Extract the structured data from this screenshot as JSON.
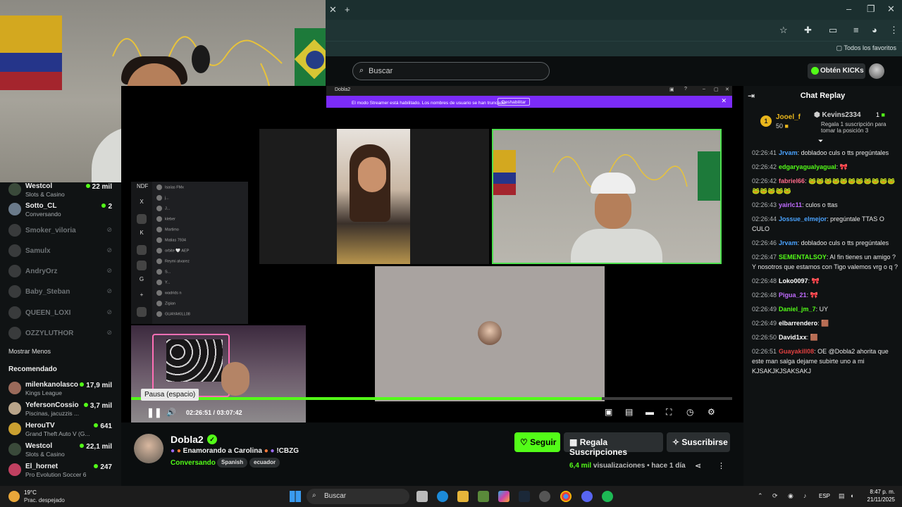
{
  "browser": {
    "tab_close": "✕",
    "tab_new": "+",
    "bookmarks_label": "Todos los favoritos"
  },
  "kick_header": {
    "search_placeholder": "Buscar",
    "kicks_button": "Obtén KICKs"
  },
  "sidebar": {
    "following": [
      {
        "name": "Westcol",
        "sub": "Slots & Casino",
        "viewers": "22 mil",
        "live": true,
        "color": "#3a4a3a"
      },
      {
        "name": "Sotto_CL",
        "sub": "Conversando",
        "viewers": "2",
        "live": true,
        "color": "#6a7a8a"
      },
      {
        "name": "Smoker_viloria",
        "live": false
      },
      {
        "name": "Samulx",
        "live": false
      },
      {
        "name": "AndryOrz",
        "live": false
      },
      {
        "name": "Baby_Steban",
        "live": false
      },
      {
        "name": "QUEEN_LOXI",
        "live": false
      },
      {
        "name": "OZZYLUTHOR",
        "live": false
      }
    ],
    "show_less": "Mostrar Menos",
    "recommended_title": "Recomendado",
    "recommended": [
      {
        "name": "milenkanolasco",
        "sub": "Kings League",
        "viewers": "17,9 mil",
        "color": "#9a6a5a"
      },
      {
        "name": "YefersonCossio",
        "sub": "Piscinas, jacuzzis ...",
        "viewers": "3,7 mil",
        "color": "#b9a58a"
      },
      {
        "name": "HerouTV",
        "sub": "Grand Theft Auto V (G...",
        "viewers": "641",
        "color": "#caa030"
      },
      {
        "name": "Westcol",
        "sub": "Slots & Casino",
        "viewers": "22,1 mil",
        "color": "#3a4a3a"
      },
      {
        "name": "El_hornet",
        "sub": "Pro Evolution Soccer 6",
        "viewers": "247",
        "color": "#c04060"
      }
    ]
  },
  "player": {
    "inner_window_title": "Dobla2",
    "streamer_mode_msg": "El modo Streamer está habilitado. Los nombres de usuario se han truncado.",
    "streamer_mode_button": "Deshabilitar",
    "discord_members": [
      "Isaías FMx",
      "j...",
      "J...",
      "kleber",
      "Martimo",
      "Matias 7934",
      "orbite 🤍 AEP",
      "Reymi alvarez",
      "S...",
      "Y...",
      "wadrids n",
      "Zigian",
      "GUAYAKILL08"
    ],
    "discord_rail": [
      "NDF",
      "X",
      "",
      "K",
      "",
      "",
      "G",
      "+",
      ""
    ],
    "tooltip": "Pausa (espacio)",
    "time_current": "02:26:51",
    "time_separator": "/",
    "time_total": "03:07:42",
    "progress": 0.7826,
    "icons": {
      "pause": "❚❚",
      "volume": "🔊"
    }
  },
  "streamer": {
    "name": "Dobla2",
    "title": "Enamorando a Carolina",
    "title_suffix": "!CBZG",
    "category": "Conversando",
    "tags": [
      "Spanish",
      "ecuador"
    ],
    "follow": "Seguir",
    "gift": "Regala Suscripciones",
    "subscribe": "Suscribirse",
    "views_num": "6,4 mil",
    "views_label": "visualizaciones",
    "ago": "hace 1 día"
  },
  "chat": {
    "title": "Chat Replay",
    "leader_rank": "1",
    "leader_user": "Jooel_f",
    "leader_points": "50",
    "second_user": "Kevins2334",
    "second_count": "1",
    "second_sub": "Regala 1 suscripción para tomar la posición 3",
    "messages": [
      {
        "ts": "02:26:41",
        "user": "Jrvam",
        "color": "#4aa3ff",
        "text": "dobladoo culs o tts pregúntales"
      },
      {
        "ts": "02:26:42",
        "user": "edgaryagualyagual",
        "color": "#53fc18",
        "text": "🎀"
      },
      {
        "ts": "02:26:42",
        "user": "fabriel66",
        "color": "#ff6b8a",
        "text": "🐸🐸🐸🐸🐸🐸🐸🐸🐸🐸🐸🐸🐸🐸🐸🐸"
      },
      {
        "ts": "02:26:43",
        "user": "yairlc11",
        "color": "#c06bff",
        "text": "culos o ttas"
      },
      {
        "ts": "02:26:44",
        "user": "Jossue_elmejor",
        "color": "#4aa3ff",
        "text": "pregúntale TTAS O CULO"
      },
      {
        "ts": "02:26:46",
        "user": "Jrvam",
        "color": "#4aa3ff",
        "text": "dobladoo culs o tts pregúntales"
      },
      {
        "ts": "02:26:47",
        "user": "SEMENTALSOY",
        "color": "#53fc18",
        "text": "Al fin tienes un amigo ? Y nosotros que estamos con Tigo valemos vrg o q ?"
      },
      {
        "ts": "02:26:48",
        "user": "Loko0097",
        "color": "#ffffff",
        "text": "🎀"
      },
      {
        "ts": "02:26:48",
        "user": "Pigua_21",
        "color": "#c06bff",
        "text": "🎀"
      },
      {
        "ts": "02:26:49",
        "user": "Daniel_jm_7",
        "color": "#53fc18",
        "text": "UY"
      },
      {
        "ts": "02:26:49",
        "user": "elbarrendero",
        "color": "#ffffff",
        "text": "🟫"
      },
      {
        "ts": "02:26:50",
        "user": "David1xx",
        "color": "#ffffff",
        "text": "🟫"
      },
      {
        "ts": "02:26:51",
        "user": "Guayakill08",
        "color": "#e04040",
        "text": "OE @Dobla2 ahorita que este man salga dejame subirte uno a mi KJSAKJKJSAKSAKJ"
      }
    ]
  },
  "taskbar": {
    "temp": "19°C",
    "weather": "Prac. despejado",
    "search": "Buscar",
    "lang": "ESP",
    "time": "8:47 p. m.",
    "date": "21/11/2025"
  },
  "colors": {
    "kick_green": "#53fc18",
    "streamer_bar": "#7b2bf9"
  }
}
